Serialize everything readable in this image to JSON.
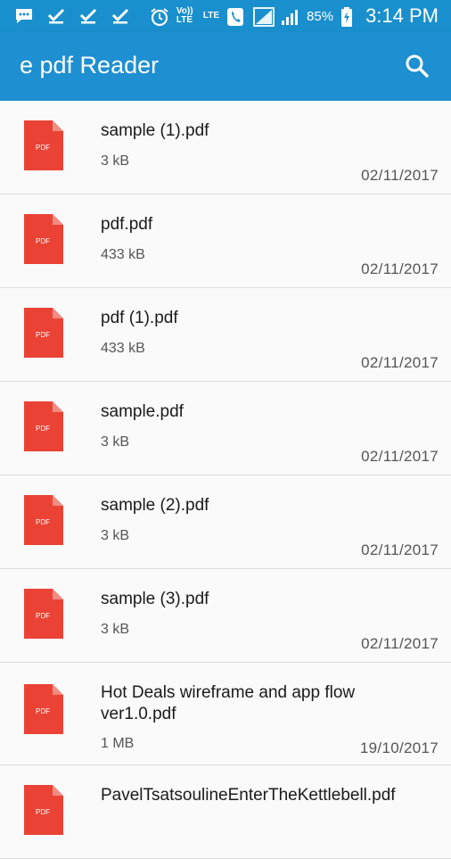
{
  "status_bar": {
    "volte_text": "Vo)) LTE",
    "lte_text": "LTE",
    "battery": "85%",
    "time": "3:14 PM"
  },
  "app_bar": {
    "title": "e pdf Reader"
  },
  "pdf_icon_label": "PDF",
  "colors": {
    "primary": "#1e8fd0",
    "pdf_red": "#ea4335"
  },
  "files": [
    {
      "name": "sample (1).pdf",
      "size": "3 kB",
      "date": "02/11/2017"
    },
    {
      "name": "pdf.pdf",
      "size": "433 kB",
      "date": "02/11/2017"
    },
    {
      "name": "pdf (1).pdf",
      "size": "433 kB",
      "date": "02/11/2017"
    },
    {
      "name": "sample.pdf",
      "size": "3 kB",
      "date": "02/11/2017"
    },
    {
      "name": "sample (2).pdf",
      "size": "3 kB",
      "date": "02/11/2017"
    },
    {
      "name": "sample (3).pdf",
      "size": "3 kB",
      "date": "02/11/2017"
    },
    {
      "name": "Hot Deals wireframe and app flow ver1.0.pdf",
      "size": "1 MB",
      "date": "19/10/2017"
    },
    {
      "name": "PavelTsatsoulineEnterTheKettlebell.pdf",
      "size": "",
      "date": ""
    }
  ]
}
